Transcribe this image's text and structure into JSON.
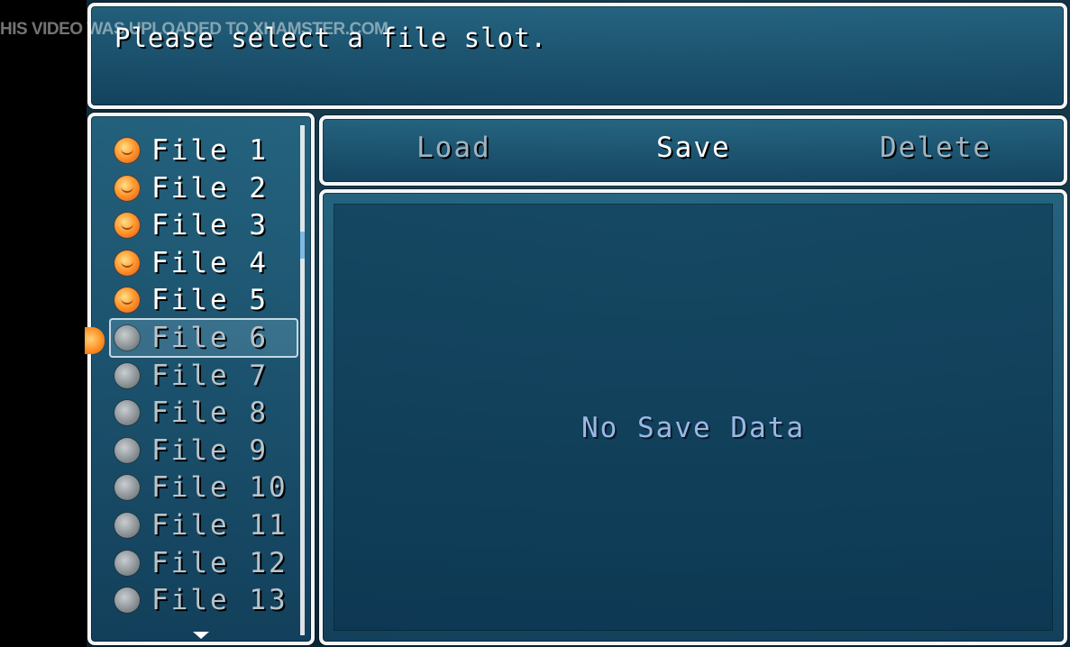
{
  "watermark": "HIS VIDEO WAS UPLOADED TO XHAMSTER.COM",
  "help": {
    "text": "Please select a file slot."
  },
  "commands": [
    {
      "label": "Load",
      "enabled": false
    },
    {
      "label": "Save",
      "enabled": true
    },
    {
      "label": "Delete",
      "enabled": false
    }
  ],
  "slots": [
    {
      "label": "File 1",
      "has_data": true
    },
    {
      "label": "File 2",
      "has_data": true
    },
    {
      "label": "File 3",
      "has_data": true
    },
    {
      "label": "File 4",
      "has_data": true
    },
    {
      "label": "File 5",
      "has_data": true
    },
    {
      "label": "File 6",
      "has_data": false,
      "selected": true
    },
    {
      "label": "File 7",
      "has_data": false
    },
    {
      "label": "File 8",
      "has_data": false
    },
    {
      "label": "File 9",
      "has_data": false
    },
    {
      "label": "File 10",
      "has_data": false
    },
    {
      "label": "File 11",
      "has_data": false
    },
    {
      "label": "File 12",
      "has_data": false
    },
    {
      "label": "File 13",
      "has_data": false
    }
  ],
  "info": {
    "message": "No Save Data"
  },
  "icons": {
    "saved": "save-orb-icon",
    "empty": "empty-orb-icon",
    "cursor": "selection-cursor-icon",
    "more": "scroll-down-arrow-icon"
  }
}
